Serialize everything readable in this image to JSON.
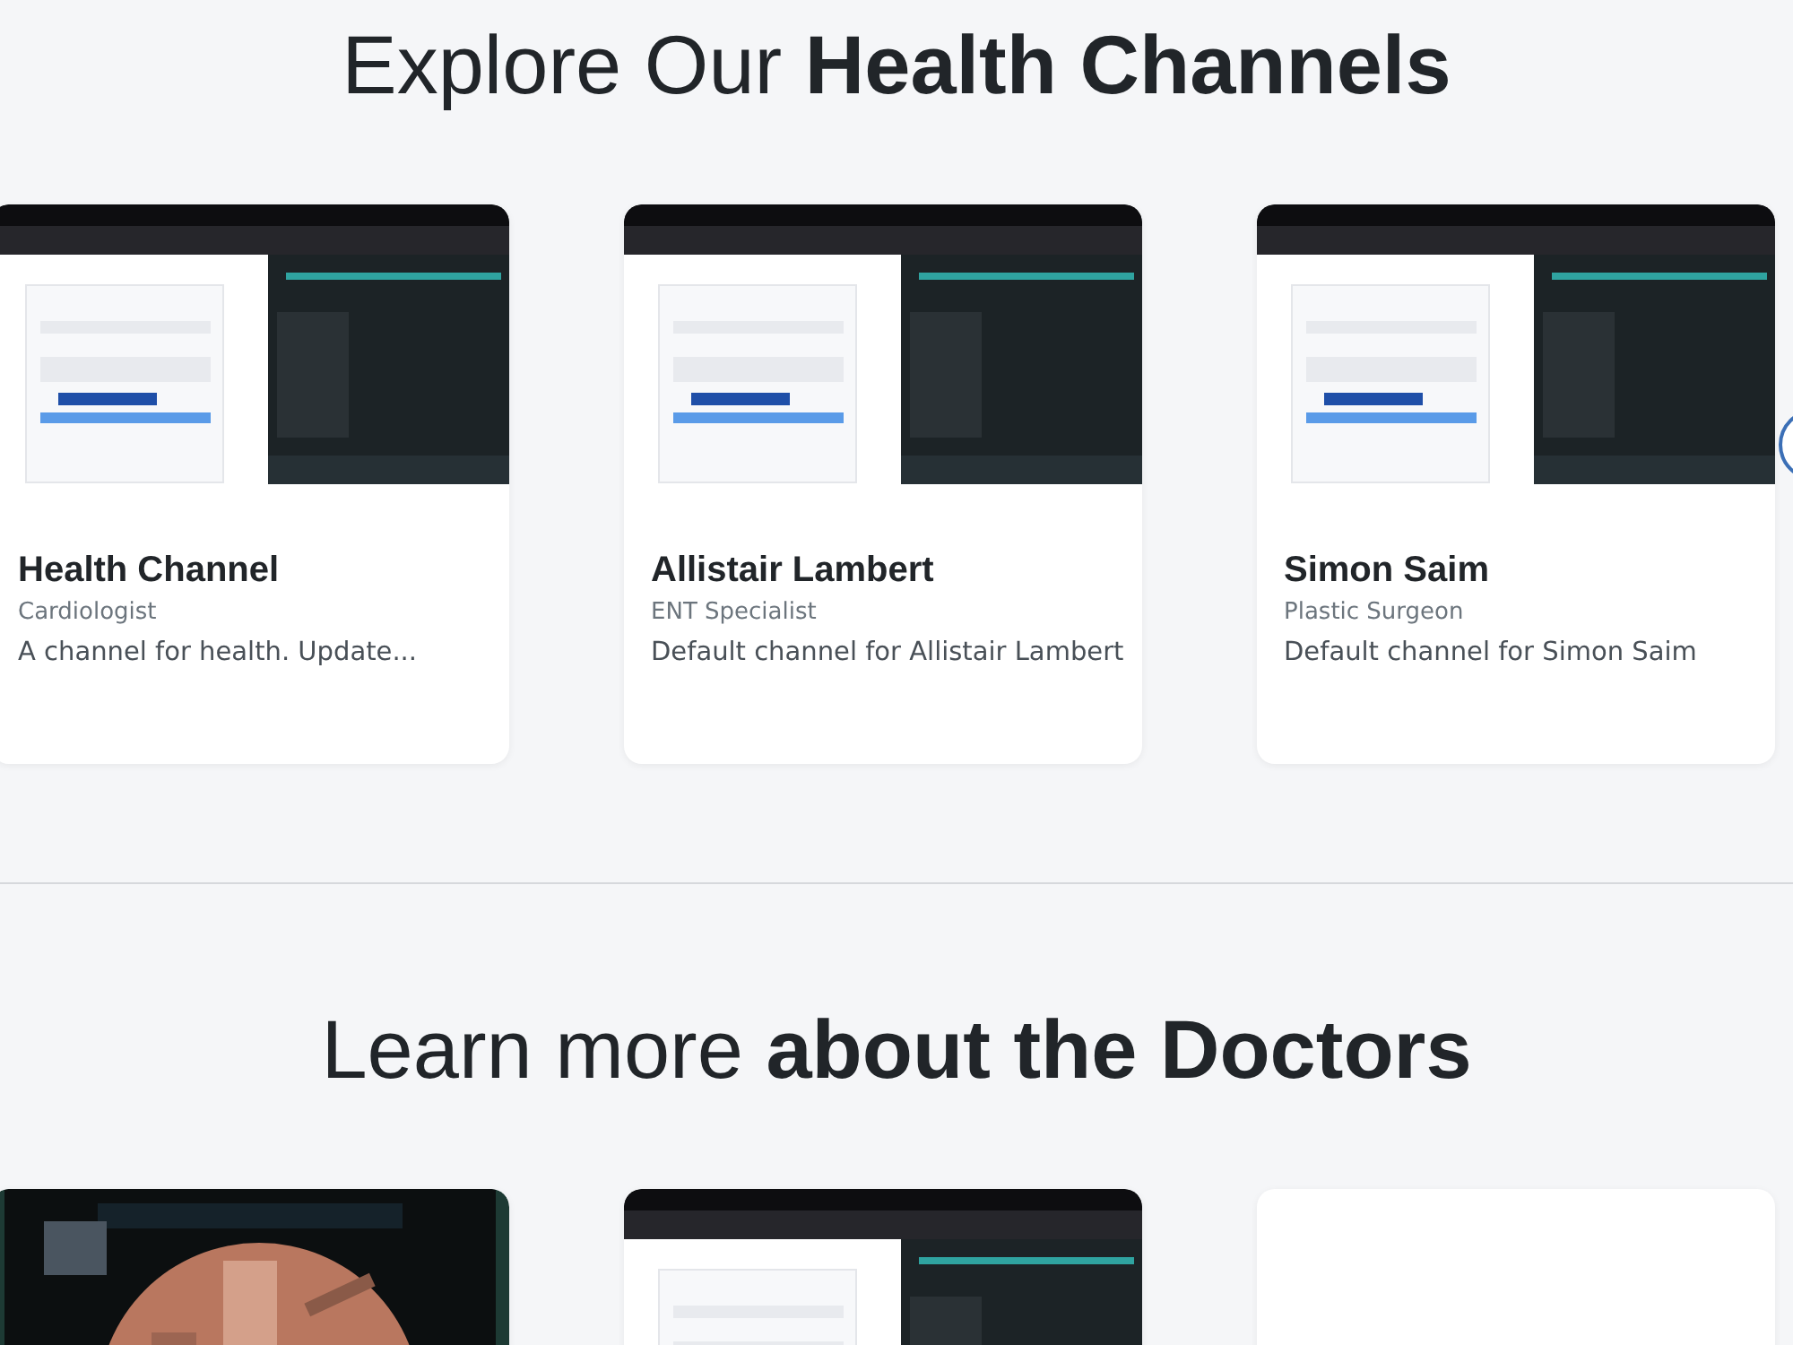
{
  "sections": [
    {
      "heading": "Explore Our **Health Channels**",
      "next_button": true,
      "cards": [
        {
          "kind": "picture",
          "name": "Health Channel",
          "specialty": "Cardiologist",
          "description": "A channel for health. Update..."
        },
        {
          "kind": "picture",
          "name": "Allistair Lambert",
          "specialty": "ENT Specialist",
          "description": "Default channel for Allistair Lambert"
        },
        {
          "kind": "picture",
          "name": "Simon Saim",
          "specialty": "Plastic Surgeon",
          "description": "Default channel for Simon Saim"
        }
      ]
    },
    {
      "heading": "Learn more **about the Doctors**",
      "cards": [
        {
          "kind": "picture"
        },
        {
          "kind": "picture"
        },
        {
          "kind": "empty"
        }
      ]
    }
  ]
}
